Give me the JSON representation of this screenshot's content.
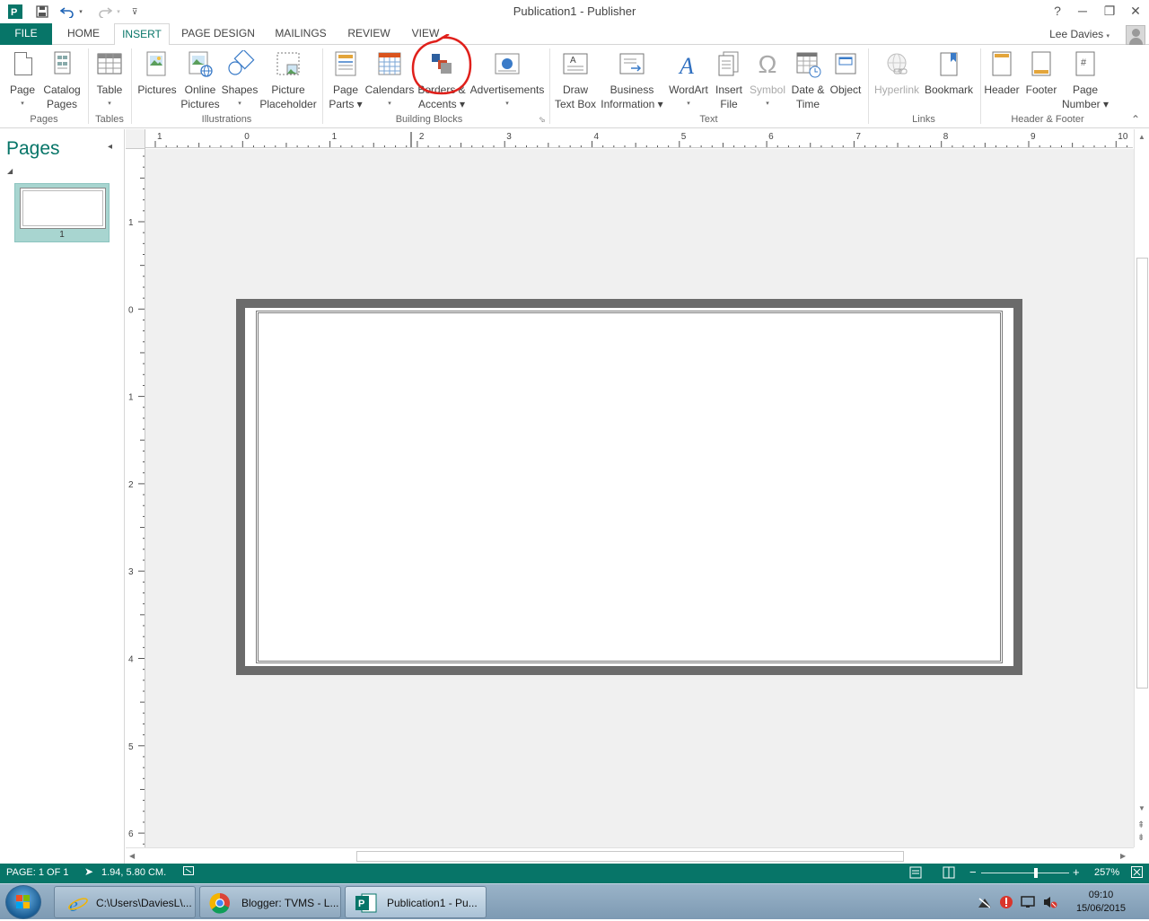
{
  "window": {
    "title": "Publication1 - Publisher",
    "help": "?",
    "min": "─",
    "restore": "❐",
    "close": "✕"
  },
  "qat": {
    "app_icon": "publisher-icon",
    "save": "save-icon",
    "undo": "undo-icon",
    "redo": "redo-icon",
    "customize": "customize-icon"
  },
  "tabs": [
    {
      "label": "FILE"
    },
    {
      "label": "HOME"
    },
    {
      "label": "INSERT"
    },
    {
      "label": "PAGE DESIGN"
    },
    {
      "label": "MAILINGS"
    },
    {
      "label": "REVIEW"
    },
    {
      "label": "VIEW"
    }
  ],
  "active_tab": "INSERT",
  "user": {
    "name": "Lee Davies"
  },
  "ribbon": {
    "groups": {
      "pages": "Pages",
      "tables": "Tables",
      "illustrations": "Illustrations",
      "building_blocks": "Building Blocks",
      "text": "Text",
      "links": "Links",
      "header_footer": "Header & Footer"
    },
    "buttons": {
      "page": {
        "l1": "Page",
        "l2": "▾"
      },
      "catalog_pages": {
        "l1": "Catalog",
        "l2": "Pages"
      },
      "table": {
        "l1": "Table",
        "l2": "▾"
      },
      "pictures": {
        "l1": "Pictures"
      },
      "online_pictures": {
        "l1": "Online",
        "l2": "Pictures"
      },
      "shapes": {
        "l1": "Shapes",
        "l2": "▾"
      },
      "picture_placeholder": {
        "l1": "Picture",
        "l2": "Placeholder"
      },
      "page_parts": {
        "l1": "Page",
        "l2": "Parts ▾"
      },
      "calendars": {
        "l1": "Calendars",
        "l2": "▾"
      },
      "borders_accents": {
        "l1": "Borders &",
        "l2": "Accents ▾"
      },
      "advertisements": {
        "l1": "Advertisements",
        "l2": "▾"
      },
      "draw_text_box": {
        "l1": "Draw",
        "l2": "Text Box"
      },
      "business_information": {
        "l1": "Business",
        "l2": "Information ▾"
      },
      "wordart": {
        "l1": "WordArt",
        "l2": "▾"
      },
      "insert_file": {
        "l1": "Insert",
        "l2": "File"
      },
      "symbol": {
        "l1": "Symbol",
        "l2": "▾"
      },
      "date_time": {
        "l1": "Date &",
        "l2": "Time"
      },
      "object": {
        "l1": "Object"
      },
      "hyperlink": {
        "l1": "Hyperlink"
      },
      "bookmark": {
        "l1": "Bookmark"
      },
      "header": {
        "l1": "Header"
      },
      "footer": {
        "l1": "Footer"
      },
      "page_number": {
        "l1": "Page",
        "l2": "Number ▾"
      }
    },
    "collapse": "⌃",
    "launcher": "⬂"
  },
  "pages_pane": {
    "title": "Pages",
    "collapse": "◂",
    "expand": "◢",
    "pages": [
      {
        "number": "1"
      }
    ]
  },
  "rulers": {
    "horizontal": [
      "1",
      "0",
      "1",
      "2",
      "3",
      "4",
      "5",
      "6",
      "7",
      "8",
      "9",
      "10"
    ],
    "vertical": [
      "1",
      "0",
      "1",
      "2",
      "3",
      "4",
      "5",
      "6"
    ]
  },
  "status": {
    "page": "PAGE: 1 OF 1",
    "position": "1.94, 5.80 CM.",
    "zoom_minus": "−",
    "zoom_plus": "+",
    "zoom": "257%",
    "zoom_fraction": 0.62
  },
  "scroll": {
    "up": "▲",
    "down": "▼",
    "left": "◀",
    "right": "▶",
    "prev_page": "⇞",
    "next_page": "⇟"
  },
  "taskbar": {
    "tasks": [
      {
        "label": "C:\\Users\\DaviesL\\...",
        "icon": "ie-icon"
      },
      {
        "label": "Blogger: TVMS - L...",
        "icon": "chrome-icon"
      },
      {
        "label": "Publication1 - Pu...",
        "icon": "publisher-icon"
      }
    ],
    "clock_time": "09:10",
    "clock_date": "15/06/2015",
    "accent": "#077568"
  }
}
